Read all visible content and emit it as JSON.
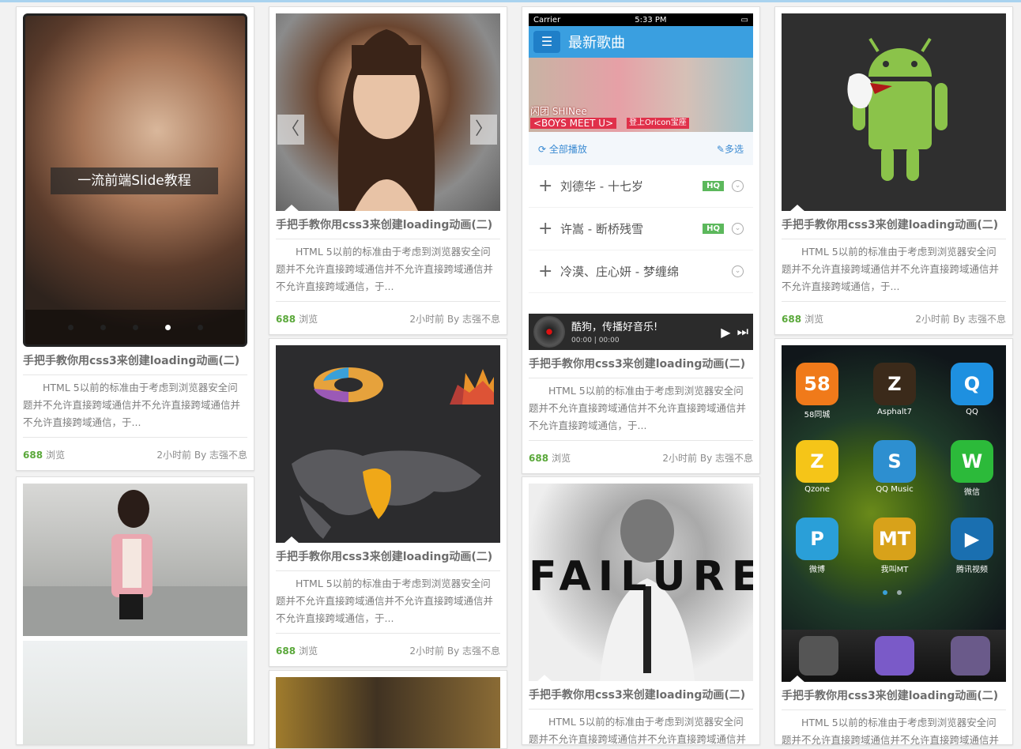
{
  "cards": {
    "title": "手把手教你用css3来创建loading动画(二)",
    "desc": "HTML 5以前的标准由于考虑到浏览器安全问题并不允许直接跨域通信并不允许直接跨域通信并不允许直接跨域通信，于...",
    "views": "688",
    "views_label": "浏览",
    "meta_right": "2小时前 By 志强不息"
  },
  "slide": {
    "caption": "一流前端Slide教程"
  },
  "carousel": {
    "prev": "〈",
    "next": "〉"
  },
  "music": {
    "status_carrier": "Carrier",
    "status_time": "5:33 PM",
    "header_title": "最新歌曲",
    "banner_line1": "闪团 SHINee",
    "banner_line2": "<BOYS MEET U>",
    "banner_line3": "登上Oricon宝座",
    "play_all": "全部播放",
    "multi_select": "多选",
    "songs": [
      {
        "name": "刘德华 - 十七岁",
        "hq": "HQ"
      },
      {
        "name": "许嵩 - 断桥残雪",
        "hq": "HQ"
      },
      {
        "name": "冷漠、庄心妍 - 梦缠绵",
        "hq": ""
      }
    ],
    "player_title": "酷狗，传播好音乐!",
    "player_time": "00:00 | 00:00"
  },
  "failure": {
    "word": "FAILURE"
  },
  "apps": [
    {
      "label": "58同城",
      "glyph": "58",
      "color": "#f07a1a"
    },
    {
      "label": "Asphalt7",
      "glyph": "Z",
      "color": "#3b2a1a"
    },
    {
      "label": "QQ",
      "glyph": "Q",
      "color": "#1e90e0"
    },
    {
      "label": "Qzone",
      "glyph": "Z",
      "color": "#f5c518"
    },
    {
      "label": "QQ Music",
      "glyph": "S",
      "color": "#2d8fd0"
    },
    {
      "label": "微信",
      "glyph": "W",
      "color": "#2cba3a"
    },
    {
      "label": "微博",
      "glyph": "P",
      "color": "#2a9fd8"
    },
    {
      "label": "我叫MT",
      "glyph": "MT",
      "color": "#d8a21a"
    },
    {
      "label": "腾讯视频",
      "glyph": "▶",
      "color": "#1a6fb0"
    }
  ],
  "colors": {
    "views_number": "#5aa83a",
    "music_header": "#3a9fe0",
    "hq_badge": "#5cb85c"
  }
}
